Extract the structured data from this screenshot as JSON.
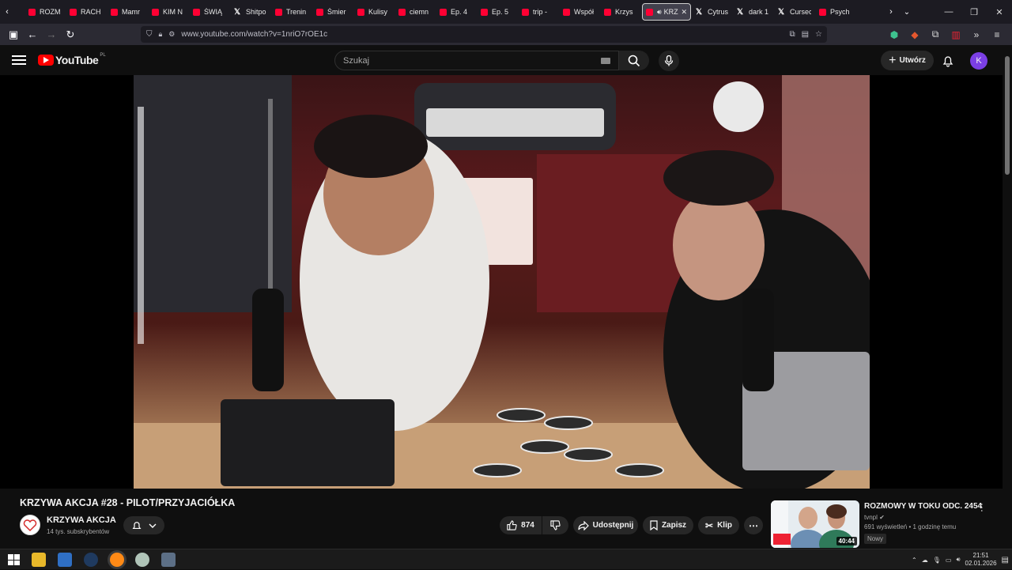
{
  "browser": {
    "tabs": [
      {
        "label": "ROZM",
        "icon": "youtube-icon"
      },
      {
        "label": "RACH",
        "icon": "youtube-icon"
      },
      {
        "label": "Mamr",
        "icon": "youtube-icon"
      },
      {
        "label": "KIM N",
        "icon": "youtube-icon"
      },
      {
        "label": "ŚWIĄ",
        "icon": "youtube-icon"
      },
      {
        "label": "Shitpo",
        "icon": "x-icon"
      },
      {
        "label": "Trenin",
        "icon": "youtube-icon"
      },
      {
        "label": "Śmier",
        "icon": "youtube-icon"
      },
      {
        "label": "Kulisy",
        "icon": "youtube-icon"
      },
      {
        "label": "ciemn",
        "icon": "youtube-icon"
      },
      {
        "label": "Ep. 4",
        "icon": "youtube-icon"
      },
      {
        "label": "Ep. 5",
        "icon": "youtube-icon"
      },
      {
        "label": "trip -",
        "icon": "youtube-icon"
      },
      {
        "label": "Współ",
        "icon": "youtube-icon"
      },
      {
        "label": "Krzys",
        "icon": "youtube-icon"
      },
      {
        "label": "KRZ",
        "icon": "youtube-icon",
        "active": true
      },
      {
        "label": "Cytrus",
        "icon": "x-icon"
      },
      {
        "label": "dark 1",
        "icon": "x-icon"
      },
      {
        "label": "Cursec",
        "icon": "x-icon"
      },
      {
        "label": "Psych",
        "icon": "youtube-icon"
      }
    ],
    "url": "www.youtube.com/watch?v=1nriO7rOE1c"
  },
  "youtube": {
    "logo_text": "YouTube",
    "country_code": "PL",
    "search_placeholder": "Szukaj",
    "create_label": "Utwórz",
    "avatar_letter": "K"
  },
  "video": {
    "title": "KRZYWA AKCJA #28 - PILOT/PRZYJACIÓŁKA",
    "channel": "KRZYWA AKCJA",
    "subscribers": "14 tys. subskrybentów",
    "likes": "874",
    "share_label": "Udostępnij",
    "save_label": "Zapisz",
    "clip_label": "Klip"
  },
  "suggestion": {
    "title": "ROZMOWY W TOKU ODC. 2454",
    "channel": "tvnpl",
    "meta": "691 wyświetleń • 1 godzinę temu",
    "badge": "Nowy",
    "duration": "40:44"
  },
  "taskbar": {
    "time": "21:51",
    "date": "02.01.2026"
  }
}
